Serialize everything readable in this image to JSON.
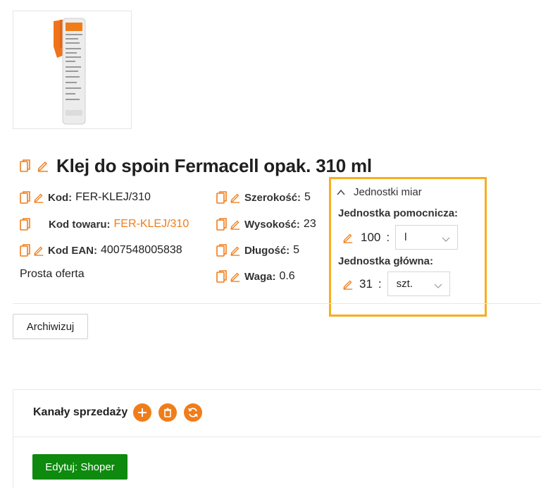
{
  "product": {
    "title": "Klej do spoin Fermacell opak. 310 ml",
    "image_icon": "sealant-tube-image"
  },
  "attributes_left": [
    {
      "label": "Kod:",
      "value": "FER-KLEJ/310"
    },
    {
      "label": "Kod towaru:",
      "value": "FER-KLEJ/310"
    },
    {
      "label": "Kod EAN:",
      "value": "4007548005838"
    }
  ],
  "attributes_right": [
    {
      "label": "Szerokość:",
      "value": "5"
    },
    {
      "label": "Wysokość:",
      "value": "23"
    },
    {
      "label": "Długość:",
      "value": "5"
    },
    {
      "label": "Waga:",
      "value": "0.6"
    }
  ],
  "simple_offer": "Prosta oferta",
  "units": {
    "header": "Jednostki miar",
    "aux_label": "Jednostka pomocnicza:",
    "aux_value": "100",
    "aux_unit": "l",
    "main_label": "Jednostka główna:",
    "main_value": "31",
    "main_unit": "szt.",
    "separator": ":"
  },
  "buttons": {
    "archive": "Archiwizuj",
    "edit_shoper": "Edytuj: Shoper"
  },
  "channels": {
    "title": "Kanały sprzedaży",
    "actions": [
      "add-icon",
      "trash-icon",
      "refresh-icon"
    ]
  },
  "colors": {
    "accent": "#f07d1a",
    "highlight_border": "#f6ae1d",
    "success": "#0e8a0e"
  }
}
